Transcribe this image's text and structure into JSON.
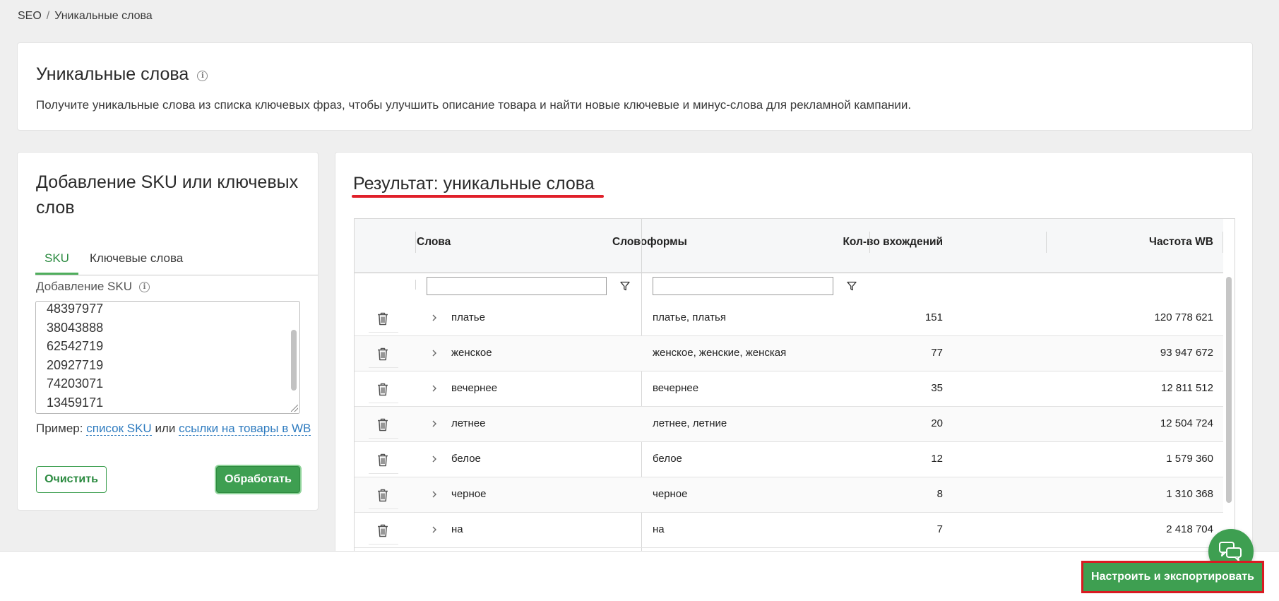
{
  "breadcrumb": {
    "root": "SEO",
    "separator": "/",
    "current": "Уникальные слова"
  },
  "intro": {
    "title": "Уникальные слова",
    "description": "Получите уникальные слова из списка ключевых фраз, чтобы улучшить описание товара и найти новые ключевые и минус-слова для рекламной кампании."
  },
  "input_panel": {
    "title": "Добавление SKU или ключевых слов",
    "tabs": [
      {
        "label": "SKU",
        "active": true
      },
      {
        "label": "Ключевые слова",
        "active": false
      }
    ],
    "field_label": "Добавление SKU",
    "sku_lines": [
      "48397977",
      "38043888",
      "62542719",
      "20927719",
      "74203071",
      "13459171"
    ],
    "example_prefix": "Пример:",
    "example_link1": "список SKU",
    "example_or": "или",
    "example_link2": "ссылки на товары в WB",
    "clear_label": "Очистить",
    "process_label": "Обработать"
  },
  "results": {
    "title": "Результат: уникальные слова",
    "columns": [
      "Слова",
      "Словоформы",
      "Кол-во вхождений",
      "Частота WB"
    ],
    "rows": [
      {
        "word": "платье",
        "forms": "платье, платья",
        "count": "151",
        "freq": "120 778 621"
      },
      {
        "word": "женское",
        "forms": "женское, женские, женская",
        "count": "77",
        "freq": "93 947 672"
      },
      {
        "word": "вечернее",
        "forms": "вечернее",
        "count": "35",
        "freq": "12 811 512"
      },
      {
        "word": "летнее",
        "forms": "летнее, летние",
        "count": "20",
        "freq": "12 504 724"
      },
      {
        "word": "белое",
        "forms": "белое",
        "count": "12",
        "freq": "1 579 360"
      },
      {
        "word": "черное",
        "forms": "черное",
        "count": "8",
        "freq": "1 310 368"
      },
      {
        "word": "на",
        "forms": "на",
        "count": "7",
        "freq": "2 418 704"
      }
    ]
  },
  "footer": {
    "export_label": "Настроить и экспортировать"
  },
  "colors": {
    "accent": "#3e9f51",
    "highlight": "#d81b22",
    "link": "#2e7bbf"
  },
  "icons": [
    "info-icon",
    "filter-icon",
    "trash-icon",
    "chevron-right-icon",
    "chat-icon"
  ]
}
